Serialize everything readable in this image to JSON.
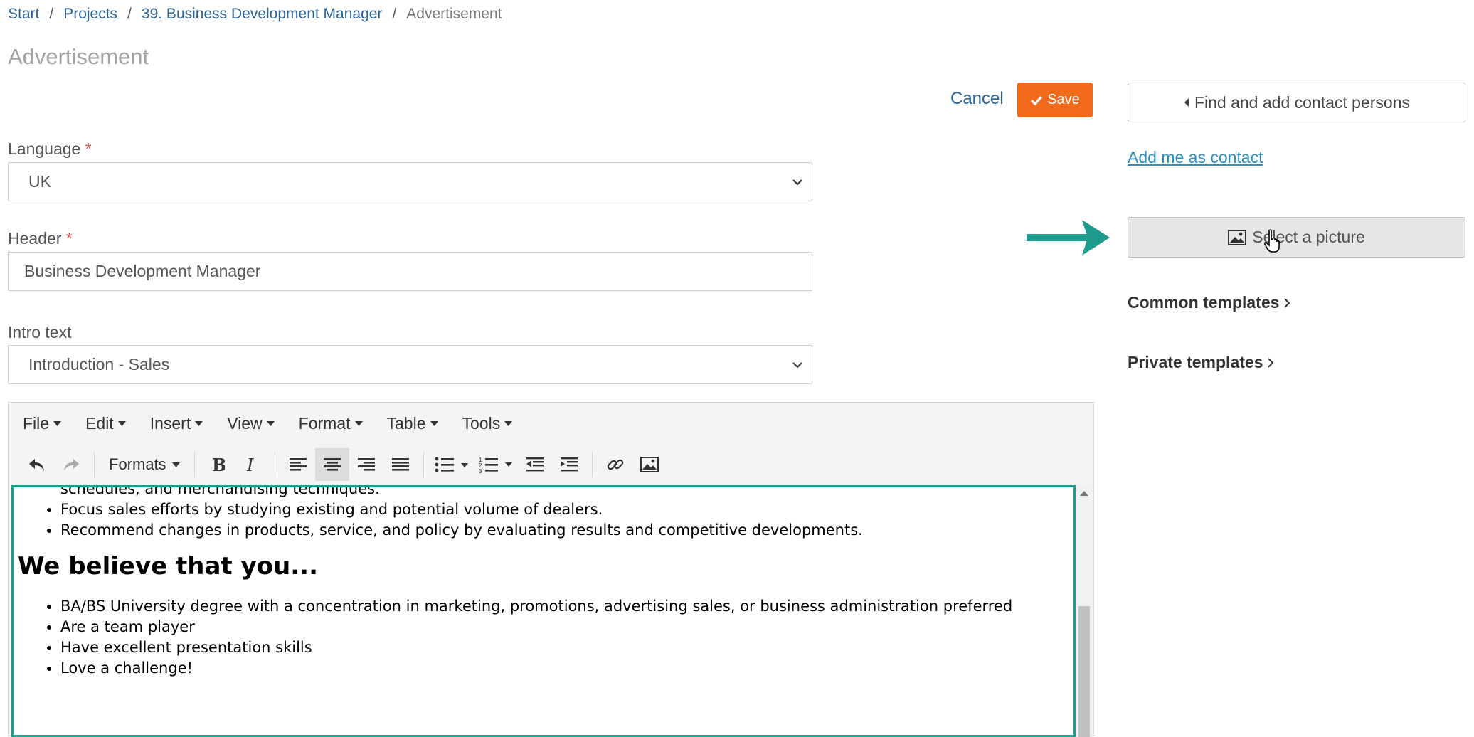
{
  "breadcrumb": {
    "items": [
      "Start",
      "Projects",
      "39. Business Development Manager"
    ],
    "current": "Advertisement",
    "separator": "/"
  },
  "page_title": "Advertisement",
  "actions": {
    "cancel": "Cancel",
    "save": "Save"
  },
  "form": {
    "language": {
      "label": "Language",
      "required": "*",
      "value": "UK"
    },
    "header": {
      "label": "Header",
      "required": "*",
      "value": "Business Development Manager"
    },
    "intro": {
      "label": "Intro text",
      "value": "Introduction - Sales"
    }
  },
  "sidebar": {
    "find_contacts": "Find and add contact persons",
    "add_me": "Add me as contact",
    "select_picture": "Select a picture",
    "common_templates": "Common templates",
    "private_templates": "Private templates"
  },
  "editor": {
    "menus": [
      "File",
      "Edit",
      "Insert",
      "View",
      "Format",
      "Table",
      "Tools"
    ],
    "formats_label": "Formats",
    "content": {
      "partial_line": "schedules, and merchandising techniques.",
      "bullets_top": [
        "Focus sales efforts by studying existing and potential volume of dealers.",
        "Recommend changes in products, service, and policy by evaluating results and competitive developments."
      ],
      "heading": "We believe that you...",
      "bullets_bottom": [
        "BA/BS University degree with a concentration in marketing, promotions, advertising sales, or business administration preferred",
        "Are a team player",
        "Have excellent presentation skills",
        "Love a challenge!"
      ]
    }
  },
  "colors": {
    "accent_orange": "#f26b1d",
    "link_blue": "#2a6496",
    "teal": "#1d9b8c"
  }
}
